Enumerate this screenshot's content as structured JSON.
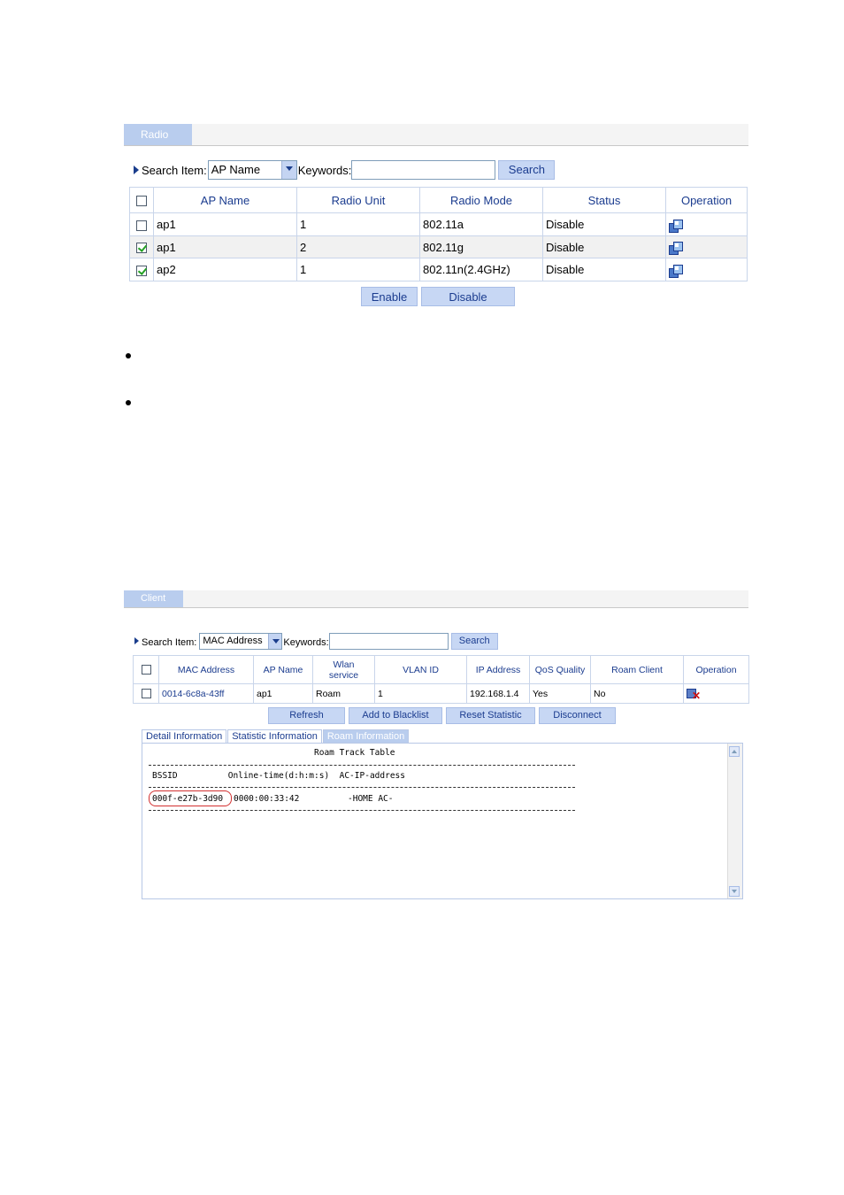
{
  "radio": {
    "tab_label": "Radio",
    "search_label": "Search Item:",
    "search_item_value": "AP Name",
    "keywords_label": "Keywords:",
    "keywords_value": "",
    "search_button": "Search",
    "columns": [
      "AP Name",
      "Radio Unit",
      "Radio Mode",
      "Status",
      "Operation"
    ],
    "rows": [
      {
        "checked": false,
        "ap_name": "ap1",
        "radio_unit": "1",
        "radio_mode": "802.11a",
        "status": "Disable"
      },
      {
        "checked": true,
        "ap_name": "ap1",
        "radio_unit": "2",
        "radio_mode": "802.11g",
        "status": "Disable"
      },
      {
        "checked": true,
        "ap_name": "ap2",
        "radio_unit": "1",
        "radio_mode": "802.11n(2.4GHz)",
        "status": "Disable"
      }
    ],
    "enable_button": "Enable",
    "disable_button": "Disable"
  },
  "client": {
    "tab_label": "Client",
    "search_label": "Search Item:",
    "search_item_value": "MAC Address",
    "keywords_label": "Keywords:",
    "keywords_value": "",
    "search_button": "Search",
    "columns": {
      "mac": "MAC Address",
      "ap": "AP Name",
      "wlan_line1": "Wlan",
      "wlan_line2": "service",
      "vlan": "VLAN ID",
      "ip": "IP Address",
      "qos": "QoS Quality",
      "roam": "Roam Client",
      "op": "Operation"
    },
    "row": {
      "checked": false,
      "mac": "0014-6c8a-43ff",
      "ap": "ap1",
      "wlan": "Roam",
      "vlan": "1",
      "ip": "192.168.1.4",
      "qos": "Yes",
      "roam": "No"
    },
    "buttons": {
      "refresh": "Refresh",
      "blacklist": "Add to Blacklist",
      "reset": "Reset Statistic",
      "disconnect": "Disconnect"
    },
    "subtabs": [
      "Detail Information",
      "Statistic Information",
      "Roam Information"
    ],
    "roam": {
      "title": "Roam Track Table",
      "header": "BSSID          Online-time(d:h:m:s)  AC-IP-address",
      "bssid": "000f-e27b-3d90",
      "online_time": "0000:00:33:42",
      "ac_ip": "-HOME AC-"
    }
  },
  "colors": {
    "accent": "#b9cdee",
    "link": "#1b3c8f",
    "highlight": "#d23030"
  }
}
